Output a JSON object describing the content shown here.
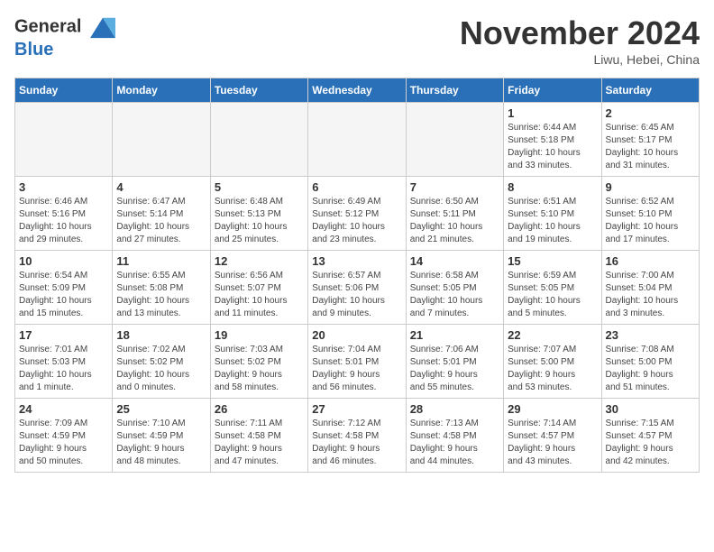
{
  "header": {
    "logo_line1": "General",
    "logo_line2": "Blue",
    "month_title": "November 2024",
    "location": "Liwu, Hebei, China"
  },
  "days_of_week": [
    "Sunday",
    "Monday",
    "Tuesday",
    "Wednesday",
    "Thursday",
    "Friday",
    "Saturday"
  ],
  "weeks": [
    [
      {
        "day": "",
        "info": ""
      },
      {
        "day": "",
        "info": ""
      },
      {
        "day": "",
        "info": ""
      },
      {
        "day": "",
        "info": ""
      },
      {
        "day": "",
        "info": ""
      },
      {
        "day": "1",
        "info": "Sunrise: 6:44 AM\nSunset: 5:18 PM\nDaylight: 10 hours\nand 33 minutes."
      },
      {
        "day": "2",
        "info": "Sunrise: 6:45 AM\nSunset: 5:17 PM\nDaylight: 10 hours\nand 31 minutes."
      }
    ],
    [
      {
        "day": "3",
        "info": "Sunrise: 6:46 AM\nSunset: 5:16 PM\nDaylight: 10 hours\nand 29 minutes."
      },
      {
        "day": "4",
        "info": "Sunrise: 6:47 AM\nSunset: 5:14 PM\nDaylight: 10 hours\nand 27 minutes."
      },
      {
        "day": "5",
        "info": "Sunrise: 6:48 AM\nSunset: 5:13 PM\nDaylight: 10 hours\nand 25 minutes."
      },
      {
        "day": "6",
        "info": "Sunrise: 6:49 AM\nSunset: 5:12 PM\nDaylight: 10 hours\nand 23 minutes."
      },
      {
        "day": "7",
        "info": "Sunrise: 6:50 AM\nSunset: 5:11 PM\nDaylight: 10 hours\nand 21 minutes."
      },
      {
        "day": "8",
        "info": "Sunrise: 6:51 AM\nSunset: 5:10 PM\nDaylight: 10 hours\nand 19 minutes."
      },
      {
        "day": "9",
        "info": "Sunrise: 6:52 AM\nSunset: 5:10 PM\nDaylight: 10 hours\nand 17 minutes."
      }
    ],
    [
      {
        "day": "10",
        "info": "Sunrise: 6:54 AM\nSunset: 5:09 PM\nDaylight: 10 hours\nand 15 minutes."
      },
      {
        "day": "11",
        "info": "Sunrise: 6:55 AM\nSunset: 5:08 PM\nDaylight: 10 hours\nand 13 minutes."
      },
      {
        "day": "12",
        "info": "Sunrise: 6:56 AM\nSunset: 5:07 PM\nDaylight: 10 hours\nand 11 minutes."
      },
      {
        "day": "13",
        "info": "Sunrise: 6:57 AM\nSunset: 5:06 PM\nDaylight: 10 hours\nand 9 minutes."
      },
      {
        "day": "14",
        "info": "Sunrise: 6:58 AM\nSunset: 5:05 PM\nDaylight: 10 hours\nand 7 minutes."
      },
      {
        "day": "15",
        "info": "Sunrise: 6:59 AM\nSunset: 5:05 PM\nDaylight: 10 hours\nand 5 minutes."
      },
      {
        "day": "16",
        "info": "Sunrise: 7:00 AM\nSunset: 5:04 PM\nDaylight: 10 hours\nand 3 minutes."
      }
    ],
    [
      {
        "day": "17",
        "info": "Sunrise: 7:01 AM\nSunset: 5:03 PM\nDaylight: 10 hours\nand 1 minute."
      },
      {
        "day": "18",
        "info": "Sunrise: 7:02 AM\nSunset: 5:02 PM\nDaylight: 10 hours\nand 0 minutes."
      },
      {
        "day": "19",
        "info": "Sunrise: 7:03 AM\nSunset: 5:02 PM\nDaylight: 9 hours\nand 58 minutes."
      },
      {
        "day": "20",
        "info": "Sunrise: 7:04 AM\nSunset: 5:01 PM\nDaylight: 9 hours\nand 56 minutes."
      },
      {
        "day": "21",
        "info": "Sunrise: 7:06 AM\nSunset: 5:01 PM\nDaylight: 9 hours\nand 55 minutes."
      },
      {
        "day": "22",
        "info": "Sunrise: 7:07 AM\nSunset: 5:00 PM\nDaylight: 9 hours\nand 53 minutes."
      },
      {
        "day": "23",
        "info": "Sunrise: 7:08 AM\nSunset: 5:00 PM\nDaylight: 9 hours\nand 51 minutes."
      }
    ],
    [
      {
        "day": "24",
        "info": "Sunrise: 7:09 AM\nSunset: 4:59 PM\nDaylight: 9 hours\nand 50 minutes."
      },
      {
        "day": "25",
        "info": "Sunrise: 7:10 AM\nSunset: 4:59 PM\nDaylight: 9 hours\nand 48 minutes."
      },
      {
        "day": "26",
        "info": "Sunrise: 7:11 AM\nSunset: 4:58 PM\nDaylight: 9 hours\nand 47 minutes."
      },
      {
        "day": "27",
        "info": "Sunrise: 7:12 AM\nSunset: 4:58 PM\nDaylight: 9 hours\nand 46 minutes."
      },
      {
        "day": "28",
        "info": "Sunrise: 7:13 AM\nSunset: 4:58 PM\nDaylight: 9 hours\nand 44 minutes."
      },
      {
        "day": "29",
        "info": "Sunrise: 7:14 AM\nSunset: 4:57 PM\nDaylight: 9 hours\nand 43 minutes."
      },
      {
        "day": "30",
        "info": "Sunrise: 7:15 AM\nSunset: 4:57 PM\nDaylight: 9 hours\nand 42 minutes."
      }
    ]
  ]
}
